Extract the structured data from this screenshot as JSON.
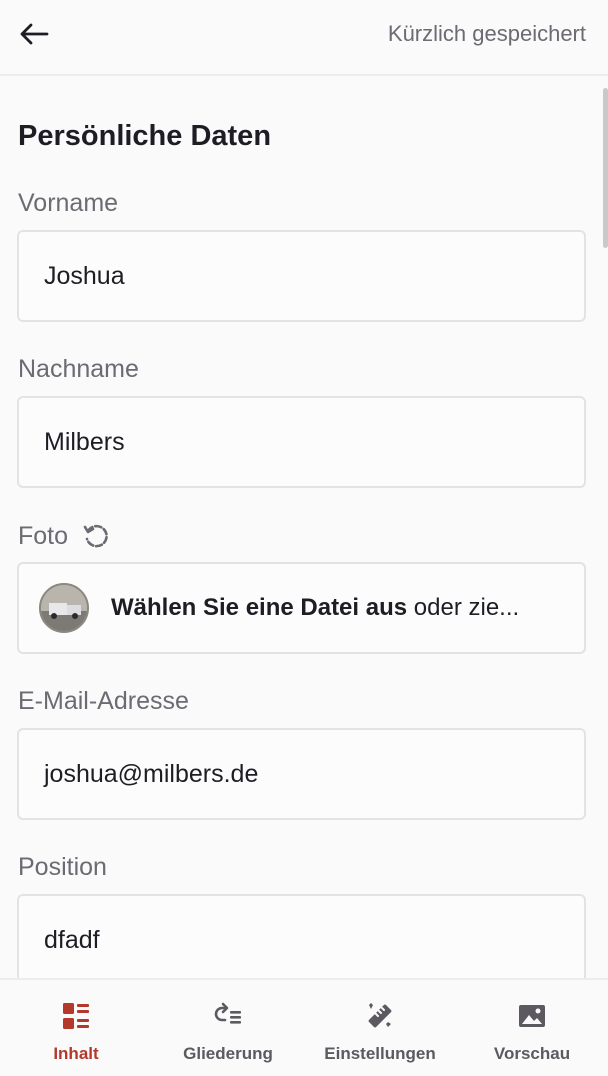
{
  "header": {
    "save_status": "Kürzlich gespeichert"
  },
  "section": {
    "title": "Persönliche Daten"
  },
  "fields": {
    "first_name": {
      "label": "Vorname",
      "value": "Joshua"
    },
    "last_name": {
      "label": "Nachname",
      "value": "Milbers"
    },
    "photo": {
      "label": "Foto",
      "choose_text": "Wählen Sie eine Datei aus",
      "drag_text": " oder zie..."
    },
    "email": {
      "label": "E-Mail-Adresse",
      "value": "joshua@milbers.de"
    },
    "position": {
      "label": "Position",
      "value": "dfadf"
    }
  },
  "nav": {
    "items": [
      {
        "label": "Inhalt",
        "icon": "content-icon",
        "active": true
      },
      {
        "label": "Gliederung",
        "icon": "structure-icon",
        "active": false
      },
      {
        "label": "Einstellungen",
        "icon": "settings-icon",
        "active": false
      },
      {
        "label": "Vorschau",
        "icon": "preview-icon",
        "active": false
      }
    ]
  },
  "colors": {
    "accent": "#b33a2b",
    "text": "#1f1d24",
    "muted": "#6c6a72",
    "border": "#e3e3e6"
  }
}
